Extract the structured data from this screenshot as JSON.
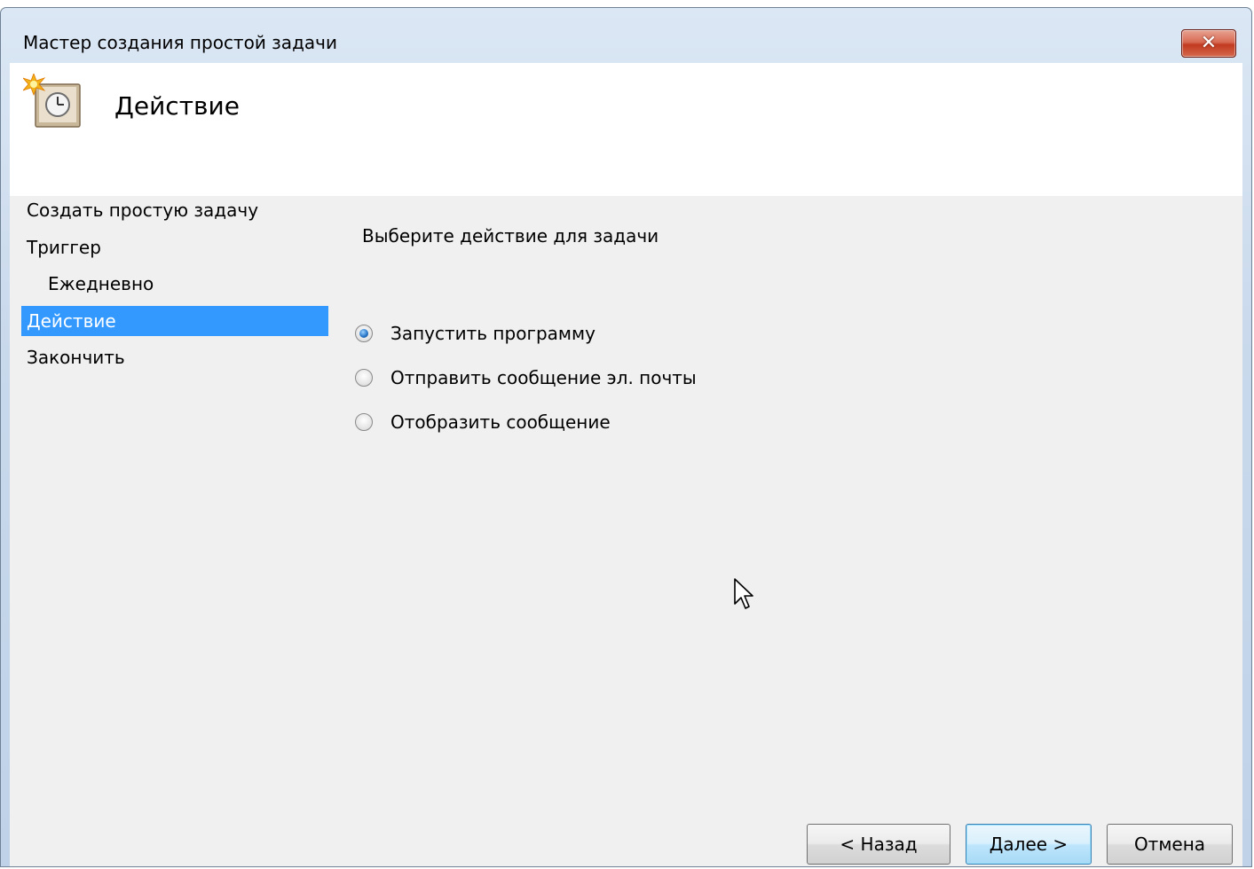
{
  "window": {
    "title": "Мастер создания простой задачи",
    "close_label": "✕"
  },
  "header": {
    "title": "Действие",
    "icon": "scheduled-task-icon"
  },
  "steps": [
    {
      "label": "Создать простую задачу",
      "indent": false,
      "selected": false
    },
    {
      "label": "Триггер",
      "indent": false,
      "selected": false
    },
    {
      "label": "Ежедневно",
      "indent": true,
      "selected": false
    },
    {
      "label": "Действие",
      "indent": false,
      "selected": true
    },
    {
      "label": "Закончить",
      "indent": false,
      "selected": false
    }
  ],
  "main": {
    "prompt": "Выберите действие для задачи",
    "options": [
      {
        "label": "Запустить программу",
        "checked": true
      },
      {
        "label": "Отправить сообщение эл. почты",
        "checked": false
      },
      {
        "label": "Отобразить сообщение",
        "checked": false
      }
    ]
  },
  "buttons": {
    "back": "< Назад",
    "next": "Далее >",
    "cancel": "Отмена"
  },
  "colors": {
    "selection": "#3399ff",
    "client_bg": "#f0f0f0",
    "close_button": "#c13a20"
  }
}
